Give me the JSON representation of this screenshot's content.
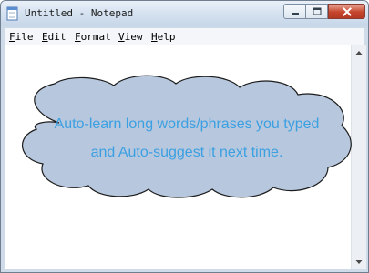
{
  "window": {
    "title": "Untitled - Notepad",
    "app_icon": "notepad-icon"
  },
  "controls": {
    "minimize_icon": "minimize-icon",
    "maximize_icon": "maximize-icon",
    "close_icon": "close-icon"
  },
  "menu": {
    "file": "File",
    "edit": "Edit",
    "format": "Format",
    "view": "View",
    "help": "Help"
  },
  "editor": {
    "text": ""
  },
  "callout": {
    "line1": "Auto-learn long words/phrases you typed",
    "line2": "and Auto-suggest it next time.",
    "fill_color": "#b7c7dd",
    "text_color": "#3ba0e2"
  },
  "scrollbar": {
    "up_icon": "scroll-up-arrow-icon",
    "down_icon": "scroll-down-arrow-icon"
  }
}
